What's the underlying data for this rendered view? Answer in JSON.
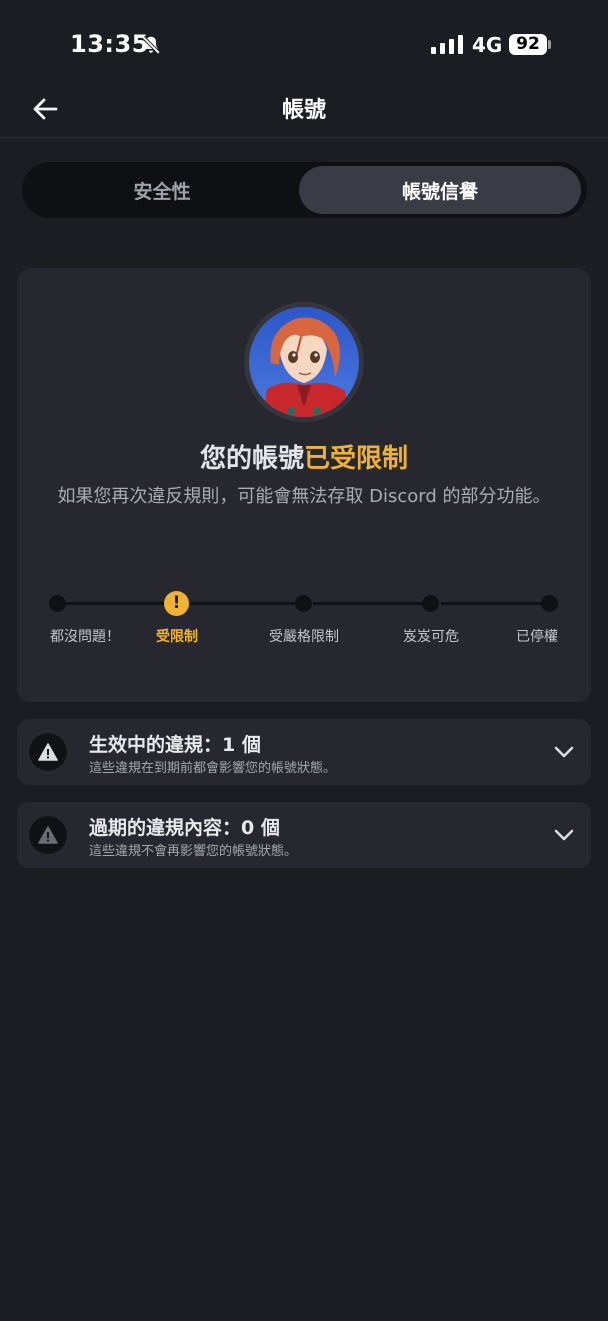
{
  "status_bar": {
    "time": "13:35",
    "network": "4G",
    "battery": "92"
  },
  "header": {
    "title": "帳號"
  },
  "tabs": [
    {
      "label": "安全性",
      "active": false
    },
    {
      "label": "帳號信譽",
      "active": true
    }
  ],
  "standing": {
    "heading_prefix": "您的帳號",
    "heading_status": "已受限制",
    "description": "如果您再次違反規則，可能會無法存取 Discord 的部分功能。",
    "accent_color": "#f0b232",
    "current_marker": "!",
    "levels": [
      "都沒問題！",
      "受限制",
      "受嚴格限制",
      "岌岌可危",
      "已停權"
    ],
    "current_level_index": 1
  },
  "violations": [
    {
      "title": "生效中的違規：1 個",
      "subtitle": "這些違規在到期前都會影響您的帳號狀態。",
      "icon": "warning-icon"
    },
    {
      "title": "過期的違規內容：0 個",
      "subtitle": "這些違規不會再影響您的帳號狀態。",
      "icon": "warning-icon"
    }
  ]
}
